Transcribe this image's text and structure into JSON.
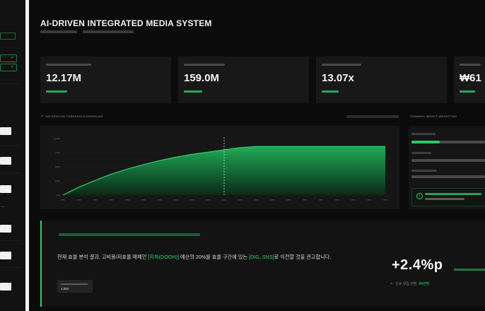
{
  "header": {
    "title": "AI-DRIVEN INTEGRATED MEDIA SYSTEM"
  },
  "kpis": [
    {
      "value": "12.17M"
    },
    {
      "value": "159.0M"
    },
    {
      "value": "13.07x"
    },
    {
      "value": "₩61"
    }
  ],
  "chart": {
    "panel_title": "SATURATION THRESHOLD MODELING",
    "x_min": 0,
    "x_max": 20,
    "threshold_x": 10,
    "curve": [
      {
        "x": 0,
        "y": 0
      },
      {
        "x": 1,
        "y": 14
      },
      {
        "x": 2,
        "y": 26
      },
      {
        "x": 3,
        "y": 37
      },
      {
        "x": 4,
        "y": 46
      },
      {
        "x": 5,
        "y": 54
      },
      {
        "x": 6,
        "y": 61
      },
      {
        "x": 7,
        "y": 67
      },
      {
        "x": 8,
        "y": 72
      },
      {
        "x": 9,
        "y": 76
      },
      {
        "x": 10,
        "y": 80
      },
      {
        "x": 11,
        "y": 84
      },
      {
        "x": 12,
        "y": 86
      },
      {
        "x": 20,
        "y": 86
      }
    ],
    "y_ticks": [
      "100%",
      "75%",
      "50%",
      "25%",
      "0%"
    ],
    "colors": {
      "accent": "#2bd36f",
      "fill_top": "#1fb35b",
      "fill_bottom": "#0a2a17"
    }
  },
  "right_panel": {
    "title": "CHANNEL IMPACT WEIGHTING",
    "bars": [
      0.38,
      1.0,
      1.0,
      1.0
    ],
    "alert_icon": "info-icon"
  },
  "insight": {
    "text_before": "현재 효율 분석 결과, 고비용/저효율 매체인 ",
    "hl1": "[지하(DOOH)]",
    "text_mid": " 예산의 20%를 효율 구간에 있는 ",
    "hl2": "[DIG, SNS]",
    "text_after": "로 이전할 것을 권고합니다.",
    "badge_value": "1,882",
    "uplift": "+2.4%p",
    "mini_label": "신규 유입 전환",
    "mini_value": "84만명"
  }
}
